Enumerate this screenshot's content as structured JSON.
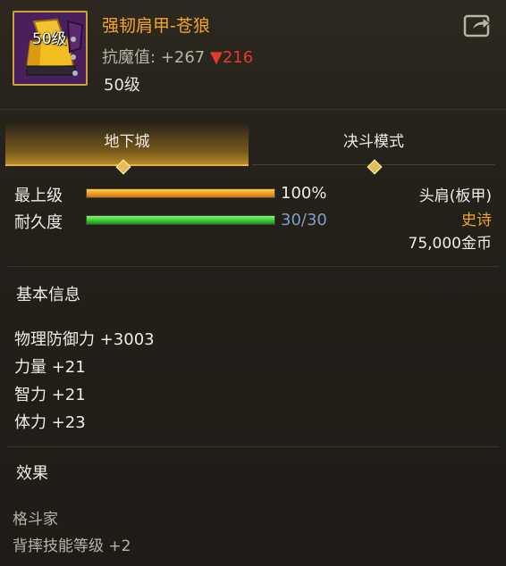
{
  "item": {
    "icon_level": "50级",
    "name": "强韧肩甲-苍狼",
    "stat_label": "抗魔值:",
    "stat_value": "+267",
    "stat_change_arrow": "▼",
    "stat_change": "216",
    "required_level": "50级",
    "share_icon": "share-arrow-icon"
  },
  "tabs": [
    {
      "label": "地下城",
      "active": true
    },
    {
      "label": "决斗模式",
      "active": false
    }
  ],
  "bars": {
    "grade": {
      "label": "最上级",
      "value_text": "100%",
      "fraction": 1.0
    },
    "durability": {
      "label": "耐久度",
      "value_text": "30/30",
      "fraction": 1.0
    }
  },
  "info": {
    "slot": "头肩(板甲)",
    "rarity": "史诗",
    "price": "75,000金币"
  },
  "basic_info": {
    "title": "基本信息",
    "attributes": [
      "物理防御力 +3003",
      "力量 +21",
      "智力 +21",
      "体力 +23"
    ]
  },
  "effects": {
    "title": "效果",
    "lines": [
      "格斗家",
      "背摔技能等级 +2"
    ]
  },
  "colors": {
    "item_name": "#f3a526",
    "rarity": "#f3a526",
    "stat_decrease": "#e33a2b",
    "grade_bar": "#f0a01e",
    "durability_bar": "#3ad236",
    "durability_text": "#7d9fc7",
    "tab_accent": "#e0b445"
  }
}
